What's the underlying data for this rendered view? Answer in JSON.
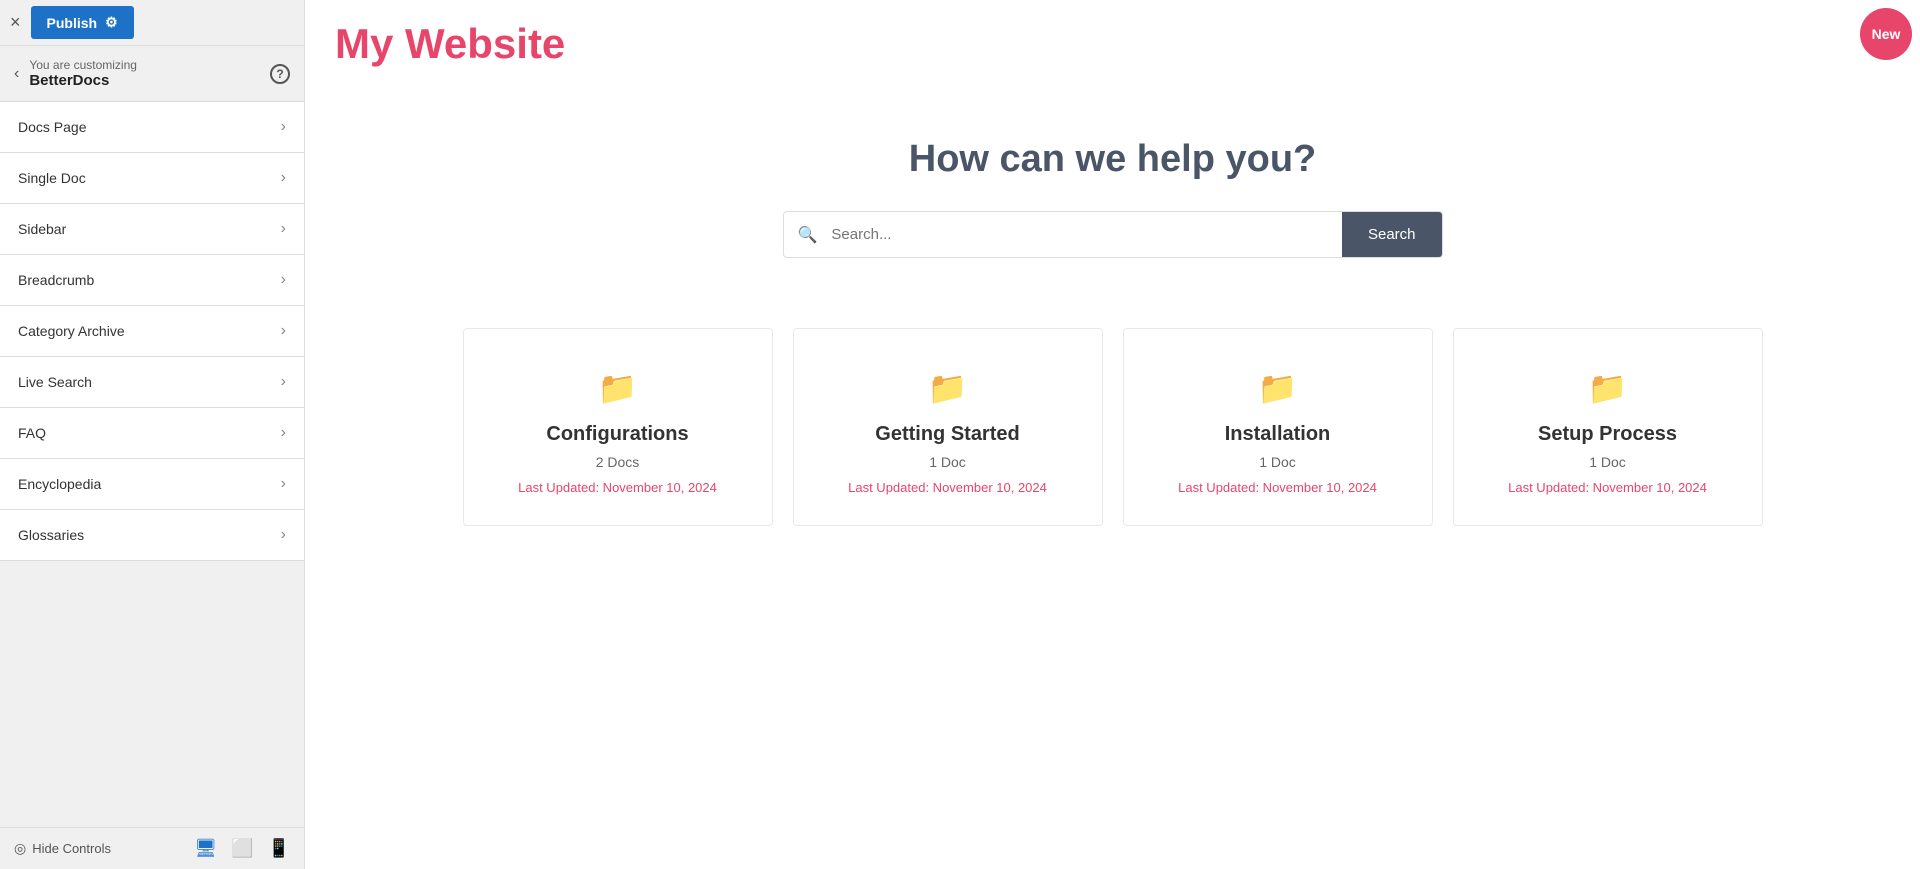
{
  "sidebar": {
    "close_label": "×",
    "publish_label": "Publish",
    "gear_label": "⚙",
    "back_label": "‹",
    "customizing_label": "You are customizing",
    "customizing_name": "BetterDocs",
    "help_label": "?",
    "nav_items": [
      {
        "label": "Docs Page",
        "id": "docs-page"
      },
      {
        "label": "Single Doc",
        "id": "single-doc"
      },
      {
        "label": "Sidebar",
        "id": "sidebar"
      },
      {
        "label": "Breadcrumb",
        "id": "breadcrumb"
      },
      {
        "label": "Category Archive",
        "id": "category-archive"
      },
      {
        "label": "Live Search",
        "id": "live-search"
      },
      {
        "label": "FAQ",
        "id": "faq"
      },
      {
        "label": "Encyclopedia",
        "id": "encyclopedia"
      },
      {
        "label": "Glossaries",
        "id": "glossaries"
      }
    ],
    "hide_controls_label": "Hide Controls",
    "footer": {
      "desktop_icon": "🖥",
      "tablet_icon": "📋",
      "mobile_icon": "📱"
    }
  },
  "main": {
    "site_title": "My Website",
    "hero_title": "How can we help you?",
    "search_placeholder": "Search...",
    "search_button_label": "Search",
    "cards": [
      {
        "title": "Configurations",
        "count": "2 Docs",
        "updated": "Last Updated: November 10, 2024"
      },
      {
        "title": "Getting Started",
        "count": "1 Doc",
        "updated": "Last Updated: November 10, 2024"
      },
      {
        "title": "Installation",
        "count": "1 Doc",
        "updated": "Last Updated: November 10, 2024"
      },
      {
        "title": "Setup Process",
        "count": "1 Doc",
        "updated": "Last Updated: November 10, 2024"
      }
    ]
  },
  "new_badge_label": "New",
  "colors": {
    "accent": "#e8456a",
    "publish_bg": "#1d72c8",
    "search_btn_bg": "#4a5568"
  }
}
